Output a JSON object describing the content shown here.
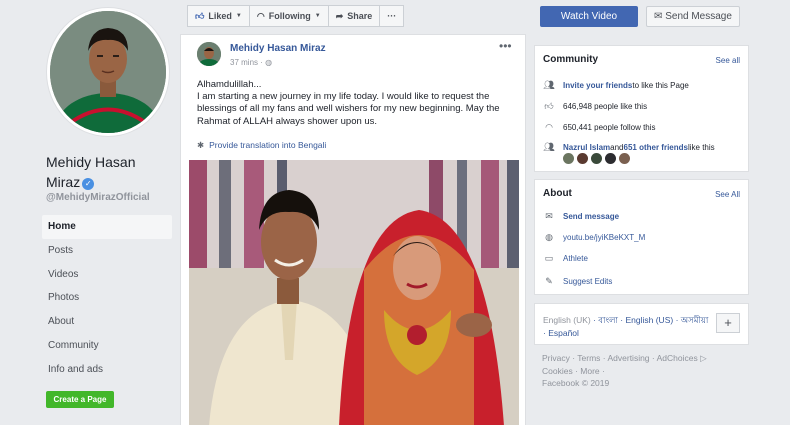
{
  "page": {
    "name_line1": "Mehidy Hasan",
    "name_line2": "Miraz",
    "handle": "@MehidyMirazOfficial",
    "verified_icon": "check-icon"
  },
  "nav": {
    "items": [
      {
        "label": "Home"
      },
      {
        "label": "Posts"
      },
      {
        "label": "Videos"
      },
      {
        "label": "Photos"
      },
      {
        "label": "About"
      },
      {
        "label": "Community"
      },
      {
        "label": "Info and ads"
      }
    ],
    "active": "Home",
    "create_page_label": "Create a Page"
  },
  "actions": {
    "liked_label": "Liked",
    "following_label": "Following",
    "share_label": "Share",
    "more_label": "···",
    "watch_video_label": "Watch Video",
    "send_message_label": "Send Message"
  },
  "post": {
    "author": "Mehidy Hasan Miraz",
    "time": "37 mins",
    "separator": "·",
    "more_label": "•••",
    "text_line1": "Alhamdulillah...",
    "text_line2": "I am starting a new journey in my life today. I would like to request the blessings of all my fans and well wishers for my new beginning. May the Rahmat of ALLAH always shower upon us.",
    "translate_label": "Provide translation into Bengali"
  },
  "community": {
    "title": "Community",
    "see_all": "See all",
    "invite_link": "Invite your friends",
    "invite_rest": " to like this Page",
    "likes": "646,948 people like this",
    "follows": "650,441 people follow this",
    "friend_name": "Nazrul Islam",
    "friend_and": " and ",
    "friend_others": "651 other friends",
    "friend_rest": " like this"
  },
  "about": {
    "title": "About",
    "see_all": "See All",
    "send_message": "Send message",
    "link": "youtu.be/jyiKBeKXT_M",
    "category": "Athlete",
    "suggest": "Suggest Edits"
  },
  "languages": {
    "current": "English (UK)",
    "others": [
      " · বাংলা",
      " · English (US)",
      " · অসমীয়া",
      " · Español"
    ],
    "plus_label": "+"
  },
  "footer": {
    "line1": "Privacy · Terms · Advertising · AdChoices ▷",
    "line2": "Cookies · More ·",
    "line3": "Facebook © 2019"
  },
  "colors": {
    "brand_blue": "#4267b2",
    "link_blue": "#365899",
    "create_green": "#42b72a",
    "page_bg": "#e9ebee"
  }
}
